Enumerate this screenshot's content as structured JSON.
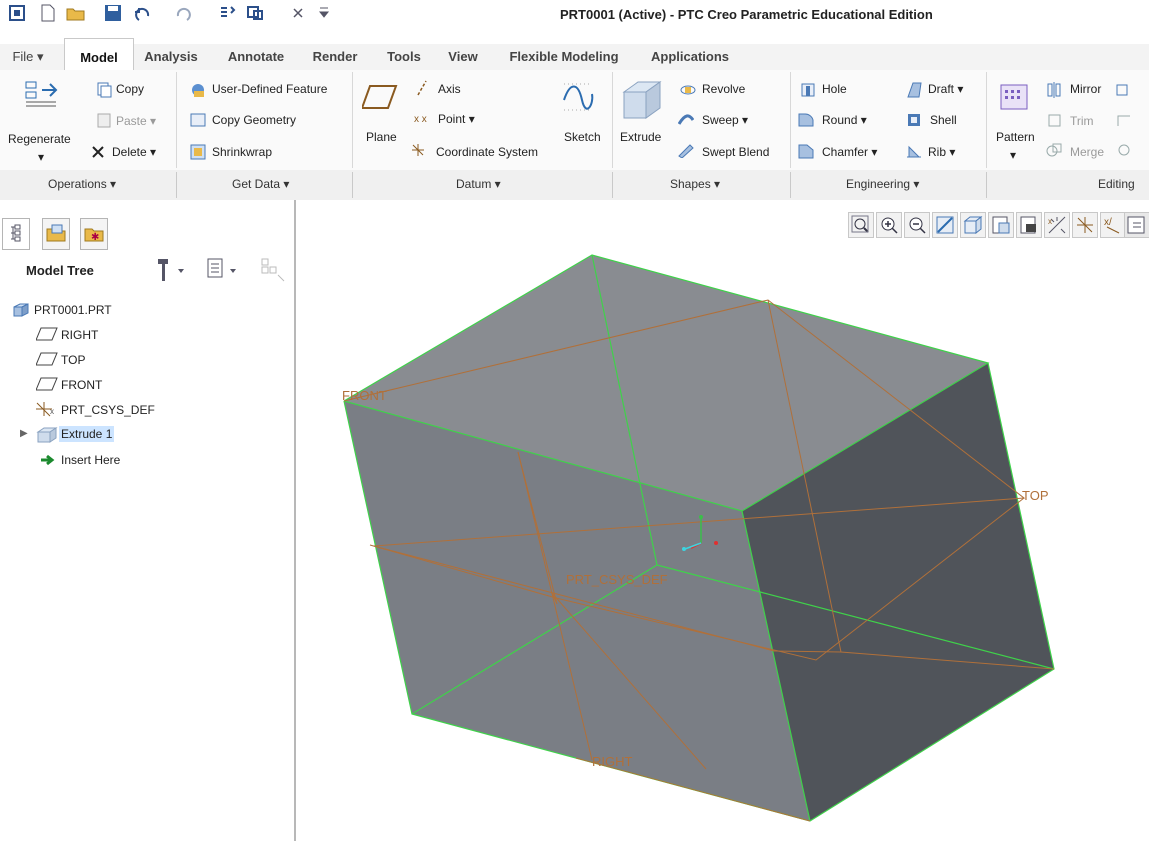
{
  "window": {
    "title": "PRT0001 (Active) - PTC Creo Parametric Educational Edition"
  },
  "tabs": [
    {
      "label": "File"
    },
    {
      "label": "Model"
    },
    {
      "label": "Analysis"
    },
    {
      "label": "Annotate"
    },
    {
      "label": "Render"
    },
    {
      "label": "Tools"
    },
    {
      "label": "View"
    },
    {
      "label": "Flexible Modeling"
    },
    {
      "label": "Applications"
    }
  ],
  "ribbon": {
    "operations": {
      "regenerate": "Regenerate",
      "copy": "Copy",
      "paste": "Paste",
      "delete": "Delete",
      "group": "Operations"
    },
    "getdata": {
      "udf": "User-Defined Feature",
      "copygeom": "Copy Geometry",
      "shrinkwrap": "Shrinkwrap",
      "group": "Get Data"
    },
    "datum": {
      "plane": "Plane",
      "axis": "Axis",
      "point": "Point",
      "csys": "Coordinate System",
      "sketch": "Sketch",
      "group": "Datum"
    },
    "shapes": {
      "extrude": "Extrude",
      "revolve": "Revolve",
      "sweep": "Sweep",
      "swept_blend": "Swept Blend",
      "group": "Shapes"
    },
    "engineering": {
      "hole": "Hole",
      "round": "Round",
      "chamfer": "Chamfer",
      "draft": "Draft",
      "shell": "Shell",
      "rib": "Rib",
      "group": "Engineering"
    },
    "editing": {
      "pattern": "Pattern",
      "mirror": "Mirror",
      "trim": "Trim",
      "merge": "Merge",
      "group": "Editing"
    }
  },
  "model_tree": {
    "title": "Model Tree",
    "items": [
      {
        "label": "PRT0001.PRT"
      },
      {
        "label": "RIGHT"
      },
      {
        "label": "TOP"
      },
      {
        "label": "FRONT"
      },
      {
        "label": "PRT_CSYS_DEF"
      },
      {
        "label": "Extrude 1"
      },
      {
        "label": "Insert Here"
      }
    ]
  },
  "viewport_labels": {
    "front": "FRONT",
    "top": "TOP",
    "right": "RIGHT",
    "csys": "PRT_CSYS_DEF"
  },
  "colors": {
    "accent": "#2b6cb0",
    "datum": "#b0703a",
    "edge": "#3fd24a",
    "face_top": "#898c91",
    "face_front": "#7a7e85",
    "face_side": "#50545a"
  }
}
